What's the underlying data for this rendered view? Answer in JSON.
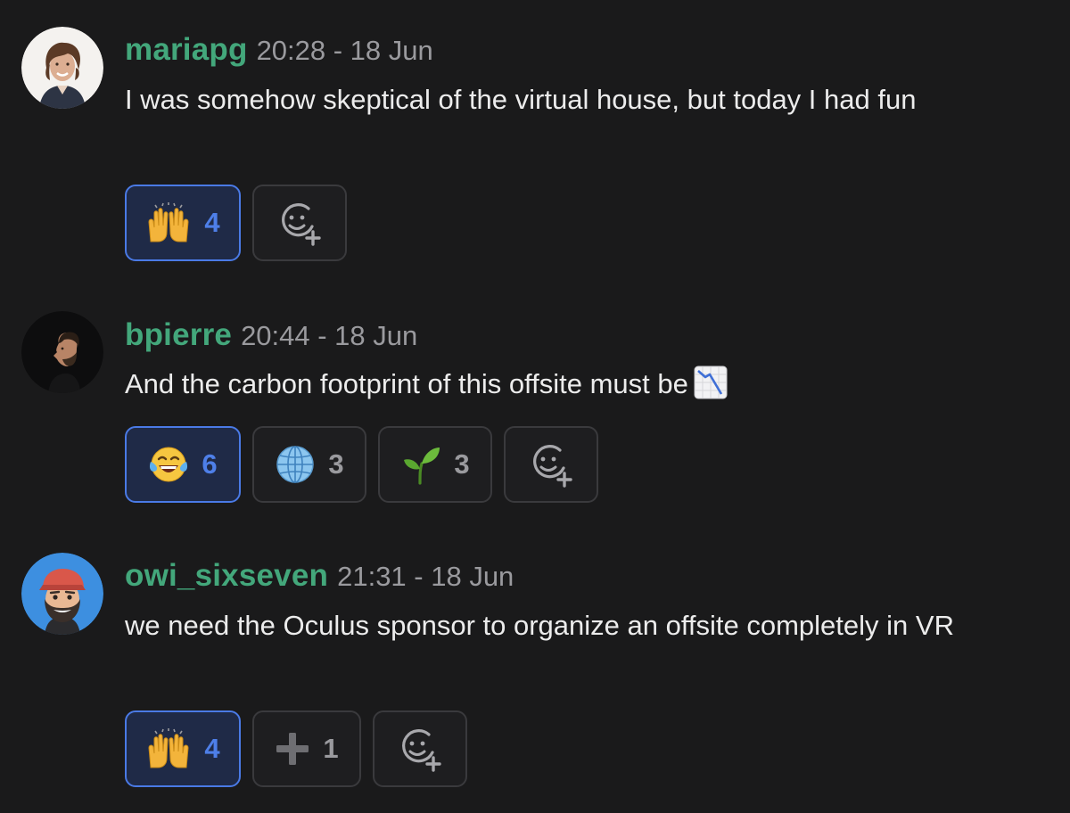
{
  "messages": [
    {
      "username": "mariapg",
      "timestamp": "20:28 - 18 Jun",
      "text": "I was somehow skeptical of the virtual house, but today I had fun",
      "avatar_icon": "woman-avatar",
      "reactions": [
        {
          "emoji_icon": "raising-hands-icon",
          "count": "4",
          "active": true
        }
      ],
      "add_reaction_icon": "add-reaction-icon"
    },
    {
      "username": "bpierre",
      "timestamp": "20:44 - 18 Jun",
      "text": "And the carbon footprint of this offsite must be",
      "inline_emoji_icon": "chart-decreasing-icon",
      "avatar_icon": "man-profile-avatar",
      "reactions": [
        {
          "emoji_icon": "tears-of-joy-icon",
          "count": "6",
          "active": true
        },
        {
          "emoji_icon": "globe-meridians-icon",
          "count": "3",
          "active": false
        },
        {
          "emoji_icon": "seedling-icon",
          "count": "3",
          "active": false
        }
      ],
      "add_reaction_icon": "add-reaction-icon"
    },
    {
      "username": "owi_sixseven",
      "timestamp": "21:31 - 18 Jun",
      "text": "we need the Oculus sponsor to organize an offsite completely in VR",
      "avatar_icon": "bearded-cartoon-avatar",
      "reactions": [
        {
          "emoji_icon": "raising-hands-icon",
          "count": "4",
          "active": true
        },
        {
          "emoji_icon": "plus-icon",
          "count": "1",
          "active": false
        }
      ],
      "add_reaction_icon": "add-reaction-icon"
    }
  ],
  "colors": {
    "background": "#1a1a1b",
    "username": "#43a77b",
    "timestamp": "#9a9a9e",
    "active_border": "#4a7ae6",
    "active_count": "#4e7fe8"
  }
}
